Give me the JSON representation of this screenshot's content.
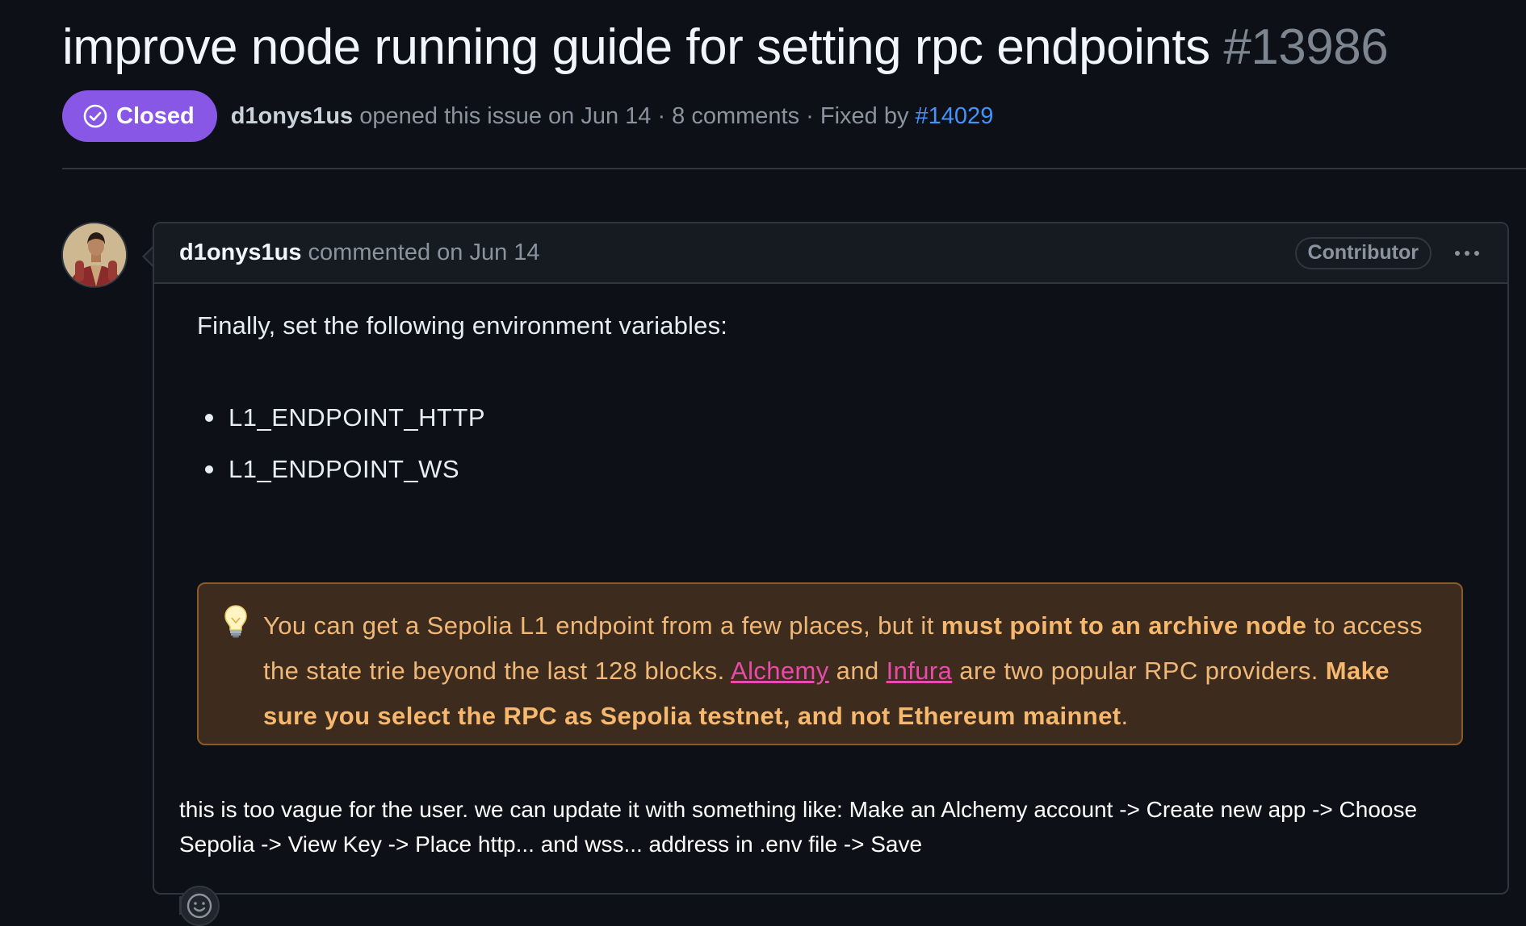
{
  "issue": {
    "title": "improve node running guide for setting rpc endpoints",
    "number": "#13986",
    "state_label": "Closed",
    "author": "d1onys1us",
    "opened_text": " opened this issue on Jun 14 · 8 comments · Fixed by ",
    "fixed_by": "#14029"
  },
  "comment": {
    "author": "d1onys1us",
    "timestamp_text": " commented on Jun 14",
    "role_badge": "Contributor",
    "menu_icon": "kebab-horizontal-icon",
    "quoted": {
      "intro": "Finally, set the following environment variables:",
      "bullets": [
        "L1_ENDPOINT_HTTP",
        "L1_ENDPOINT_WS"
      ],
      "callout": {
        "icon": "lightbulb-icon",
        "part1": "You can get a Sepolia L1 endpoint from a few places, but it ",
        "bold1": "must point to an archive node",
        "part2": " to access the state trie beyond the last 128 blocks. ",
        "link1": "Alchemy",
        "part3": " and ",
        "link2": "Infura",
        "part4": " are two popular RPC providers. ",
        "bold2": "Make sure you select the RPC as Sepolia testnet, and not Ethereum mainnet",
        "part5": "."
      }
    },
    "reply": "this is too vague for the user. we can update it with something like: Make an Alchemy account -> Create new app -> Choose Sepolia -> View Key -> Place http... and wss... address in .env file -> Save",
    "reaction_icon": "smiley-icon"
  },
  "colors": {
    "background": "#0d1117",
    "closed_badge": "#8957e5",
    "link": "#4493f8",
    "callout_bg": "#3d2c1d",
    "callout_border": "#8a5a2a",
    "callout_text": "#f0b878",
    "callout_link": "#ea4aaa"
  }
}
